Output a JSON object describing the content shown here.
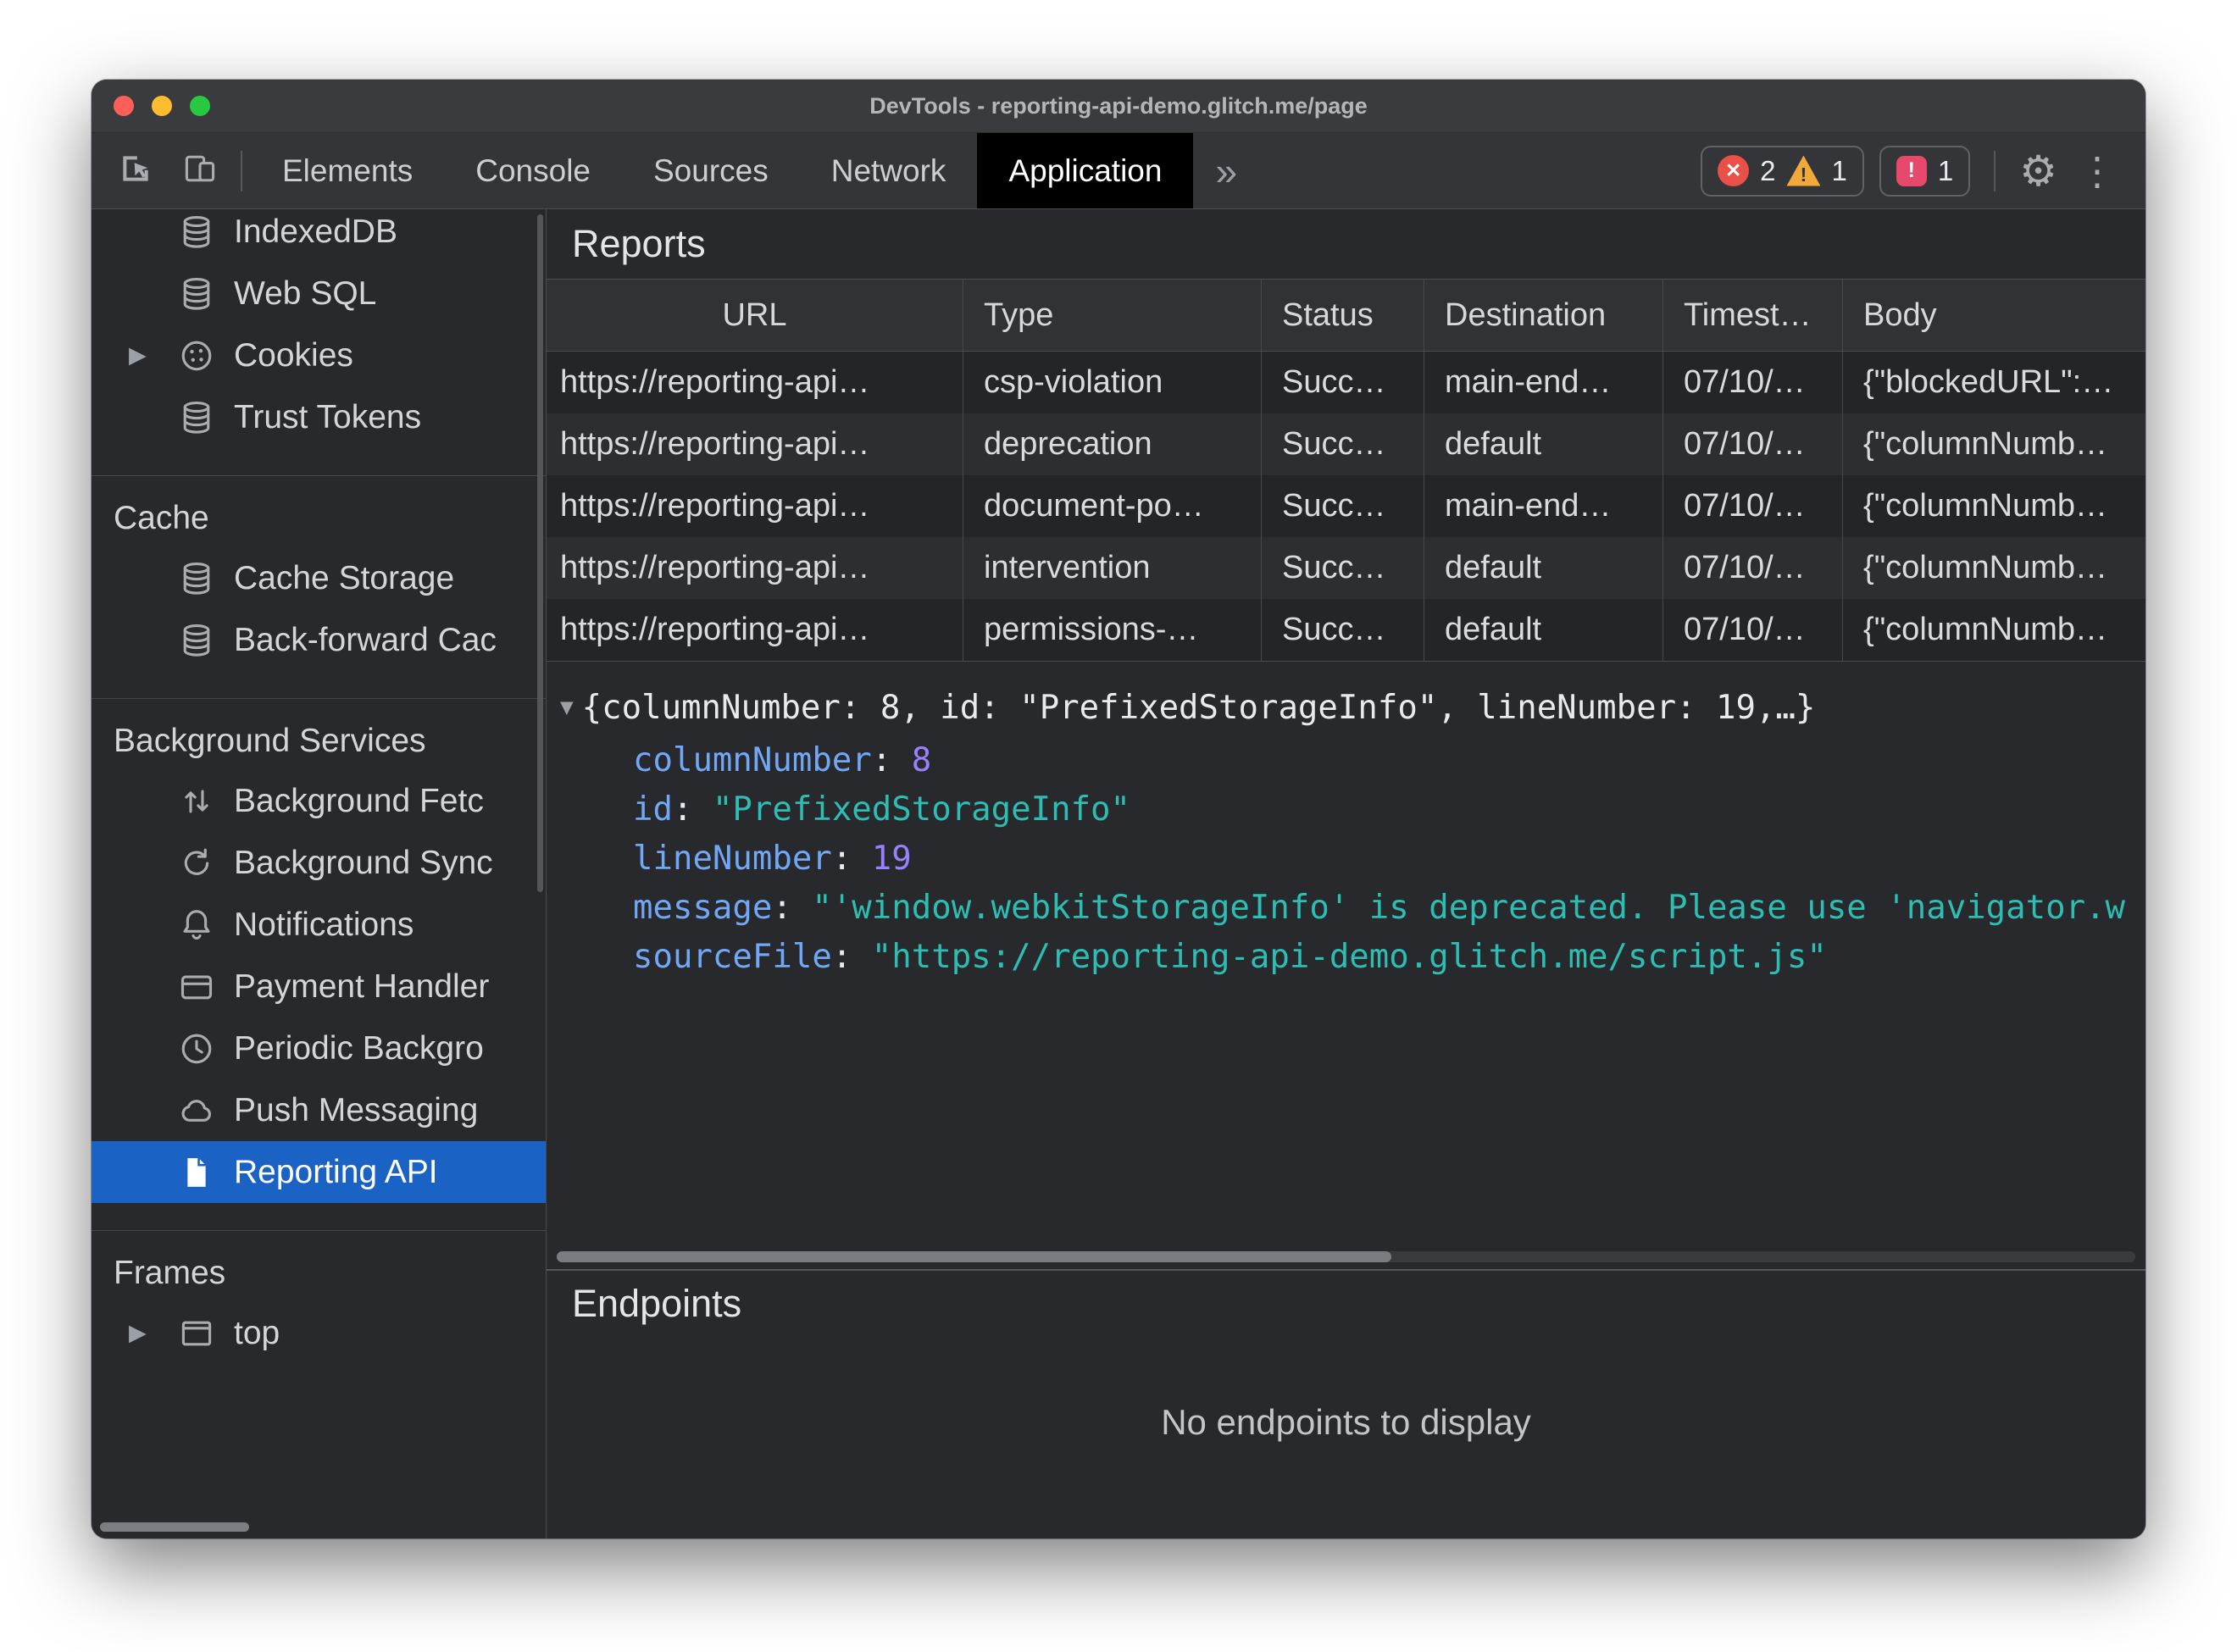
{
  "window": {
    "title": "DevTools - reporting-api-demo.glitch.me/page"
  },
  "colors": {
    "selection": "#1a63c4",
    "error": "#e85048",
    "warning": "#f2a93b",
    "issue": "#e6496b",
    "tab_active_bg": "#000000"
  },
  "toolbar": {
    "tabs": [
      {
        "label": "Elements"
      },
      {
        "label": "Console"
      },
      {
        "label": "Sources"
      },
      {
        "label": "Network"
      },
      {
        "label": "Application"
      }
    ],
    "more_label": "»",
    "badges": {
      "errors": "2",
      "warnings": "1",
      "issues": "1"
    }
  },
  "sidebar": {
    "groups": [
      {
        "title": "",
        "items": [
          {
            "label": "IndexedDB"
          },
          {
            "label": "Web SQL"
          },
          {
            "label": "Cookies"
          },
          {
            "label": "Trust Tokens"
          }
        ]
      },
      {
        "title": "Cache",
        "items": [
          {
            "label": "Cache Storage"
          },
          {
            "label": "Back-forward Cac"
          }
        ]
      },
      {
        "title": "Background Services",
        "items": [
          {
            "label": "Background Fetc"
          },
          {
            "label": "Background Sync"
          },
          {
            "label": "Notifications"
          },
          {
            "label": "Payment Handler"
          },
          {
            "label": "Periodic Backgro"
          },
          {
            "label": "Push Messaging"
          },
          {
            "label": "Reporting API"
          }
        ]
      },
      {
        "title": "Frames",
        "items": [
          {
            "label": "top"
          }
        ]
      }
    ]
  },
  "reports": {
    "title": "Reports",
    "columns": [
      "URL",
      "Type",
      "Status",
      "Destination",
      "Timest…",
      "Body"
    ],
    "rows": [
      {
        "url": "https://reporting-api…",
        "type": "csp-violation",
        "status": "Succ…",
        "destination": "main-end…",
        "timestamp": "07/10/…",
        "body": "{\"blockedURL\":…"
      },
      {
        "url": "https://reporting-api…",
        "type": "deprecation",
        "status": "Succ…",
        "destination": "default",
        "timestamp": "07/10/…",
        "body": "{\"columnNumb…"
      },
      {
        "url": "https://reporting-api…",
        "type": "document-po…",
        "status": "Succ…",
        "destination": "main-end…",
        "timestamp": "07/10/…",
        "body": "{\"columnNumb…"
      },
      {
        "url": "https://reporting-api…",
        "type": "intervention",
        "status": "Succ…",
        "destination": "default",
        "timestamp": "07/10/…",
        "body": "{\"columnNumb…"
      },
      {
        "url": "https://reporting-api…",
        "type": "permissions-…",
        "status": "Succ…",
        "destination": "default",
        "timestamp": "07/10/…",
        "body": "{\"columnNumb…"
      }
    ]
  },
  "detail": {
    "preview": "{columnNumber: 8, id: \"PrefixedStorageInfo\", lineNumber: 19,…}",
    "props": [
      {
        "key": "columnNumber",
        "value": "8"
      },
      {
        "key": "id",
        "value": "\"PrefixedStorageInfo\""
      },
      {
        "key": "lineNumber",
        "value": "19"
      },
      {
        "key": "message",
        "value": "\"'window.webkitStorageInfo' is deprecated. Please use 'navigator.w"
      },
      {
        "key": "sourceFile",
        "value": "\"https://reporting-api-demo.glitch.me/script.js\""
      }
    ]
  },
  "endpoints": {
    "title": "Endpoints",
    "empty_message": "No endpoints to display"
  }
}
